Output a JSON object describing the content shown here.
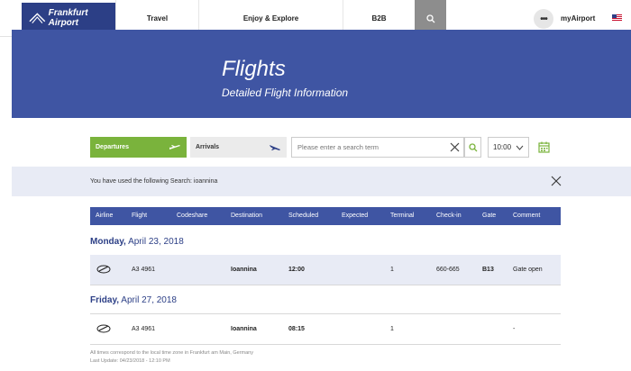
{
  "nav": {
    "logo_text": "Frankfurt Airport",
    "items": [
      "Travel",
      "Enjoy & Explore",
      "B2B"
    ],
    "dots": "•••",
    "my_airport": "myAirport"
  },
  "hero": {
    "title": "Flights",
    "subtitle": "Detailed Flight Information"
  },
  "search": {
    "departures_label": "Departures",
    "arrivals_label": "Arrivals",
    "placeholder": "Please enter a search term",
    "time_value": "10:00"
  },
  "info": {
    "text": "You have used the following Search: ioannina"
  },
  "table": {
    "columns": [
      "Airline",
      "Flight",
      "Codeshare",
      "Destination",
      "Scheduled",
      "Expected",
      "Terminal",
      "Check-in",
      "Gate",
      "Comment"
    ],
    "days": [
      {
        "weekday": "Monday,",
        "date": "April 23, 2018",
        "rows": [
          {
            "flight": "A3 4961",
            "codeshare": "",
            "destination": "Ioannina",
            "scheduled": "12:00",
            "expected": "",
            "terminal": "1",
            "checkin": "660-665",
            "gate": "B13",
            "comment": "Gate open"
          }
        ]
      },
      {
        "weekday": "Friday,",
        "date": "April 27, 2018",
        "rows": [
          {
            "flight": "A3 4961",
            "codeshare": "",
            "destination": "Ioannina",
            "scheduled": "08:15",
            "expected": "",
            "terminal": "1",
            "checkin": "",
            "gate": "",
            "comment": "-"
          }
        ]
      }
    ]
  },
  "footer": {
    "line1": "All times correspond to the local time zone in Frankfurt am Main, Germany",
    "line2": "Last Update: 04/23/2018 - 12:10 PM"
  },
  "colors": {
    "brand_blue": "#3f55a3",
    "departures_green": "#7ab33c",
    "info_bg": "#e8ebf5"
  }
}
